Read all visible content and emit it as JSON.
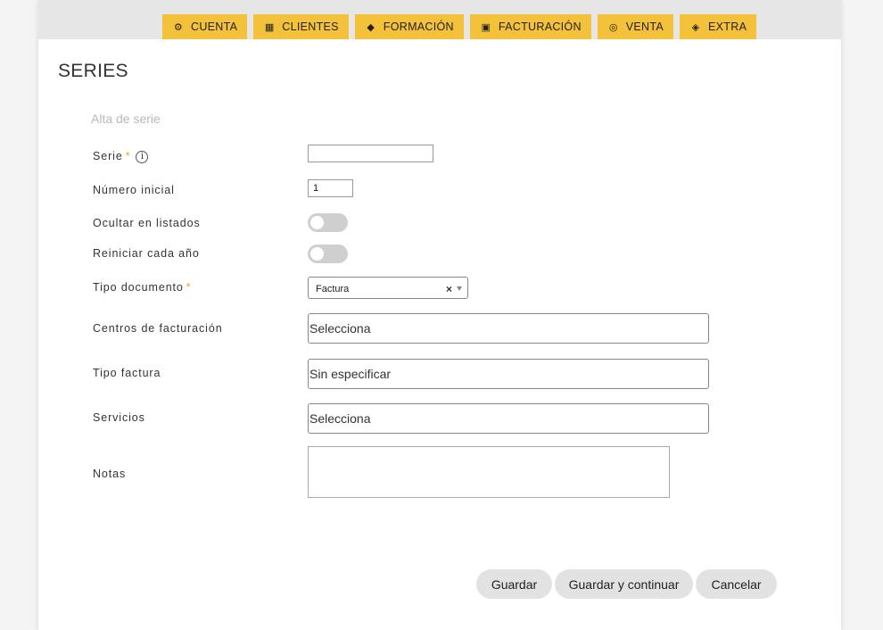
{
  "nav": {
    "items": [
      {
        "label": "CUENTA",
        "icon": "gears-icon"
      },
      {
        "label": "CLIENTES",
        "icon": "building-icon"
      },
      {
        "label": "FORMACIÓN",
        "icon": "graduation-cap-icon"
      },
      {
        "label": "FACTURACIÓN",
        "icon": "money-bill-icon"
      },
      {
        "label": "VENTA",
        "icon": "coins-icon"
      },
      {
        "label": "EXTRA",
        "icon": "tag-icon"
      }
    ],
    "accent_color": "#f4c13a"
  },
  "page": {
    "title": "SERIES",
    "subtitle": "Alta de serie"
  },
  "form": {
    "serie": {
      "label": "Serie",
      "required_mark": "*",
      "info_glyph": "i",
      "value": ""
    },
    "numero_inicial": {
      "label": "Número inicial",
      "value": "1"
    },
    "ocultar": {
      "label": "Ocultar en listados",
      "checked": false
    },
    "reiniciar": {
      "label": "Reiniciar cada año",
      "checked": false
    },
    "tipo_documento": {
      "label": "Tipo documento",
      "required_mark": "*",
      "value": "Factura",
      "clear_glyph": "×"
    },
    "centros": {
      "label": "Centros de facturación",
      "value": "Selecciona"
    },
    "tipo_factura": {
      "label": "Tipo factura",
      "value": "Sin especificar"
    },
    "servicios": {
      "label": "Servicios",
      "value": "Selecciona"
    },
    "notas": {
      "label": "Notas",
      "value": ""
    }
  },
  "buttons": {
    "guardar": "Guardar",
    "guardar_continuar": "Guardar y continuar",
    "cancelar": "Cancelar"
  }
}
